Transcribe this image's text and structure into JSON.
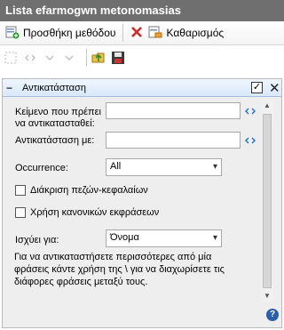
{
  "window": {
    "title": "Lista efarmogwn metonomasias"
  },
  "toolbar": {
    "add_method_label": "Προσθήκη μεθόδου",
    "clear_label": "Καθαρισμός"
  },
  "panel": {
    "title": "Αντικατάσταση",
    "pin_checked": true,
    "find_label": "Κείμενο που πρέπει να αντικατασταθεί:",
    "find_value": "",
    "replace_label": "Αντικατάσταση με:",
    "replace_value": "",
    "occurrence_label": "Occurrence:",
    "occurrence_value": "All",
    "case_sensitive_label": "Διάκριση πεζών-κεφαλαίων",
    "regex_label": "Χρήση κανονικών εκφράσεων",
    "applies_to_label": "Ισχύει για:",
    "applies_to_value": "Όνομα",
    "help_text": "Για να αντικαταστήσετε περισσότερες από μία φράσεις κάντε χρήση της \\ για να διαχωρίσετε τις διάφορες φράσεις μεταξύ τους."
  },
  "icons": {
    "add": "add-method-icon",
    "clear": "clear-x-icon",
    "eraser": "eraser-icon",
    "help": "help-icon"
  },
  "colors": {
    "title_bar": "#6f6f6f",
    "panel_header": "#d9e8fb",
    "accent_blue": "#1a6fcc",
    "clear_red": "#d12a2a"
  }
}
